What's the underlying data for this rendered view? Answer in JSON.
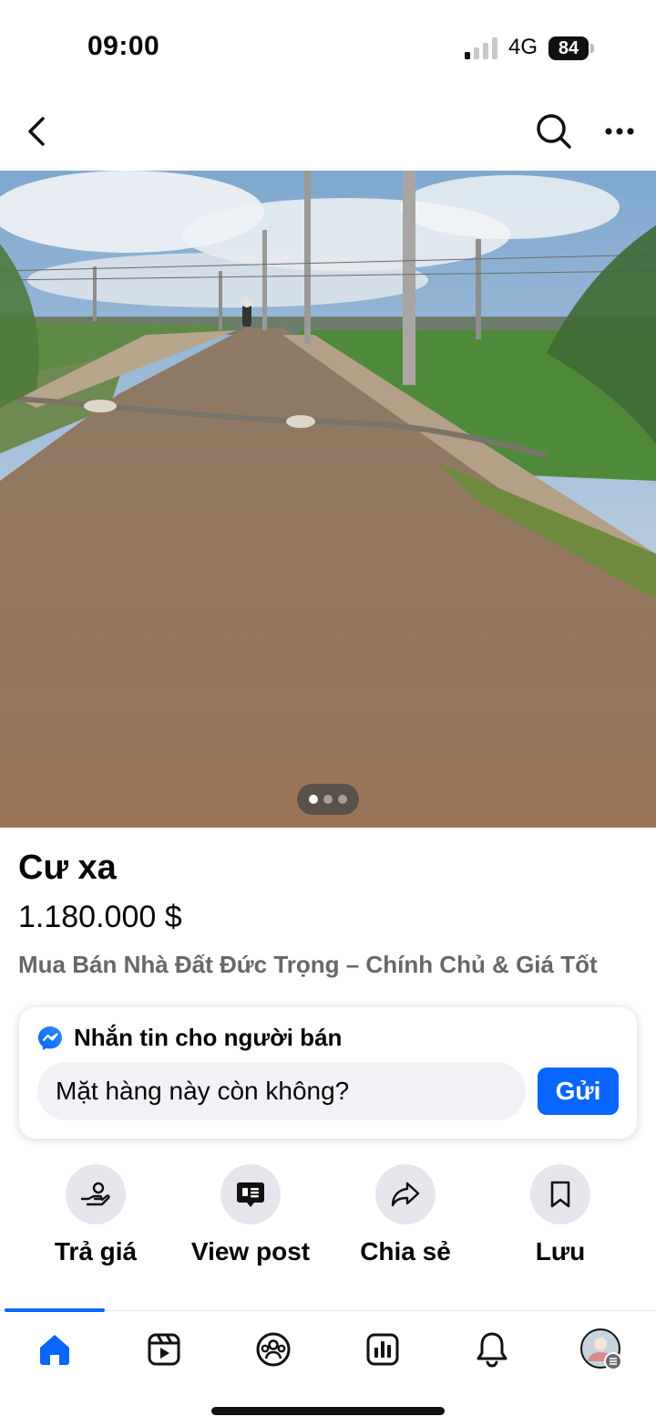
{
  "status_bar": {
    "time": "09:00",
    "network": "4G",
    "battery": "84",
    "icons": [
      "signal-icon",
      "battery-icon"
    ]
  },
  "nav": {
    "icons": [
      "back-arrow-icon",
      "search-icon",
      "more-icon"
    ]
  },
  "photo": {
    "pages": 3,
    "current_page": 1
  },
  "listing": {
    "title": "Cư xa",
    "price": "1.180.000 $",
    "group": "Mua Bán Nhà Đất Đức Trọng – Chính Chủ & Giá Tốt"
  },
  "message": {
    "header": "Nhắn tin cho người bán",
    "input_value": "Mặt hàng này còn không?",
    "send_label": "Gửi",
    "icon": "messenger-icon"
  },
  "actions": [
    {
      "label": "Trả giá",
      "icon": "offer-hand-icon"
    },
    {
      "label": "View post",
      "icon": "post-icon"
    },
    {
      "label": "Chia sẻ",
      "icon": "share-icon"
    },
    {
      "label": "Lưu",
      "icon": "bookmark-icon"
    }
  ],
  "tabbar": {
    "items": [
      "home-icon",
      "video-icon",
      "groups-icon",
      "marketplace-icon",
      "notifications-icon",
      "profile-avatar"
    ],
    "active": "home-icon"
  },
  "colors": {
    "accent": "#0866ff",
    "secondary_text": "#65676b",
    "button_bg": "#e4e6eb",
    "input_bg": "#f0f2f5"
  }
}
